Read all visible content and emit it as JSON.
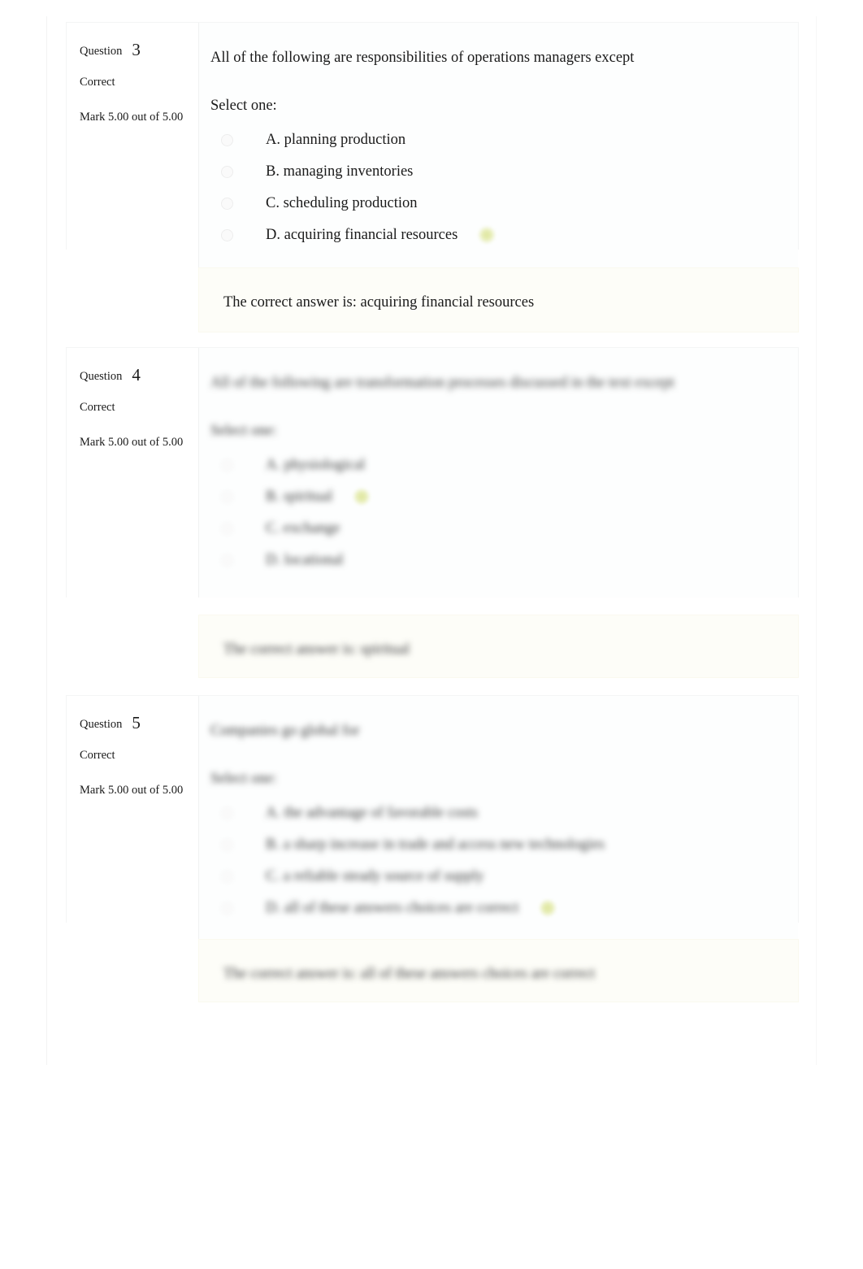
{
  "page": {
    "background_color": "#ffffff",
    "text_color": "#1a1a1a",
    "accent_correct_color": "#dde59a",
    "feedback_background_color": "#fdfdf8"
  },
  "questions": [
    {
      "info": {
        "question_label": "Question",
        "number": "3",
        "state": "Correct",
        "grade": "Mark 5.00 out of 5.00"
      },
      "stem": "All of the following are responsibilities of operations managers except",
      "prompt": "Select one:",
      "answers": [
        {
          "label": "A. planning production",
          "correct": false
        },
        {
          "label": "B. managing inventories",
          "correct": false
        },
        {
          "label": "C. scheduling production",
          "correct": false
        },
        {
          "label": "D. acquiring financial resources",
          "correct": true
        }
      ],
      "feedback": "The correct answer is: acquiring financial resources",
      "obscured": false
    },
    {
      "info": {
        "question_label": "Question",
        "number": "4",
        "state": "Correct",
        "grade": "Mark 5.00 out of 5.00"
      },
      "stem": "All of the following are transformation processes discussed in the text except",
      "prompt": "Select one:",
      "answers": [
        {
          "label": "A. physiological",
          "correct": false
        },
        {
          "label": "B. spiritual",
          "correct": true
        },
        {
          "label": "C. exchange",
          "correct": false
        },
        {
          "label": "D. locational",
          "correct": false
        }
      ],
      "feedback": "The correct answer is: spiritual",
      "obscured": true
    },
    {
      "info": {
        "question_label": "Question",
        "number": "5",
        "state": "Correct",
        "grade": "Mark 5.00 out of 5.00"
      },
      "stem": "Companies go global for",
      "prompt": "Select one:",
      "answers": [
        {
          "label": "A. the advantage of favorable costs",
          "correct": false
        },
        {
          "label": "B. a sharp increase in trade and access new technologies",
          "correct": false
        },
        {
          "label": "C. a reliable steady source of supply",
          "correct": false
        },
        {
          "label": "D. all of these answers choices are correct",
          "correct": true
        }
      ],
      "feedback": "The correct answer is: all of these answers choices are correct",
      "obscured": true
    }
  ],
  "icons": {
    "radio": "radio-button-icon",
    "correct_marker": "correct-check-icon"
  }
}
